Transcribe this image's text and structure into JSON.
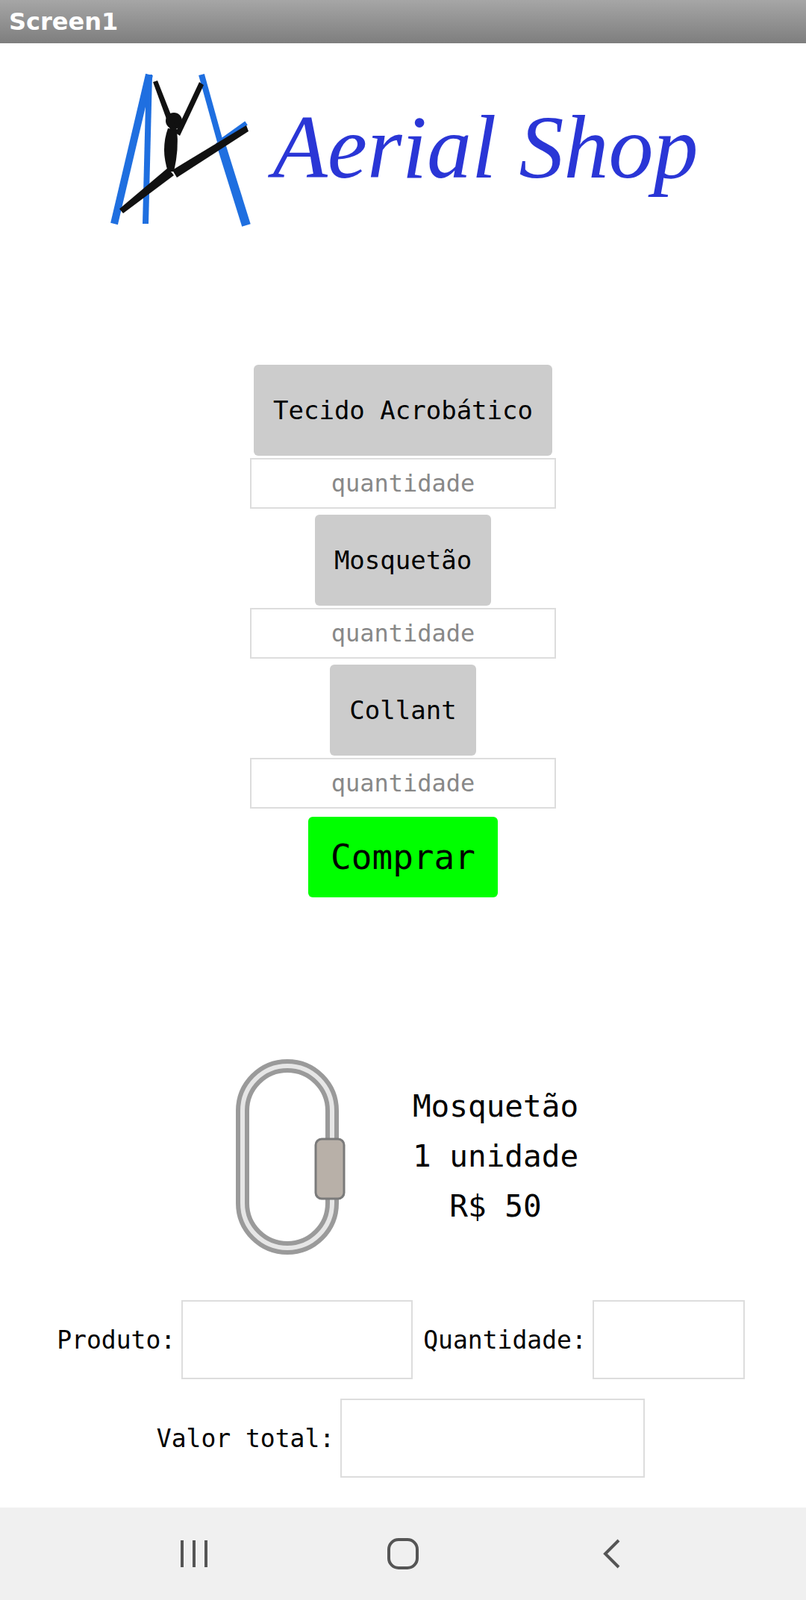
{
  "window": {
    "title": "Screen1"
  },
  "logo": {
    "text": "Aerial Shop"
  },
  "products": [
    {
      "label": "Tecido Acrobático",
      "placeholder": "quantidade"
    },
    {
      "label": "Mosquetão",
      "placeholder": "quantidade"
    },
    {
      "label": "Collant",
      "placeholder": "quantidade"
    }
  ],
  "buy_button": "Comprar",
  "selected_product": {
    "name": "Mosquetão",
    "quantity": "1 unidade",
    "price": "R$ 50"
  },
  "form": {
    "rows": [
      [
        {
          "label": "Produto:",
          "value": ""
        },
        {
          "label": "Quantidade:",
          "value": ""
        }
      ],
      [
        {
          "label": "Valor total:",
          "value": ""
        }
      ]
    ]
  }
}
